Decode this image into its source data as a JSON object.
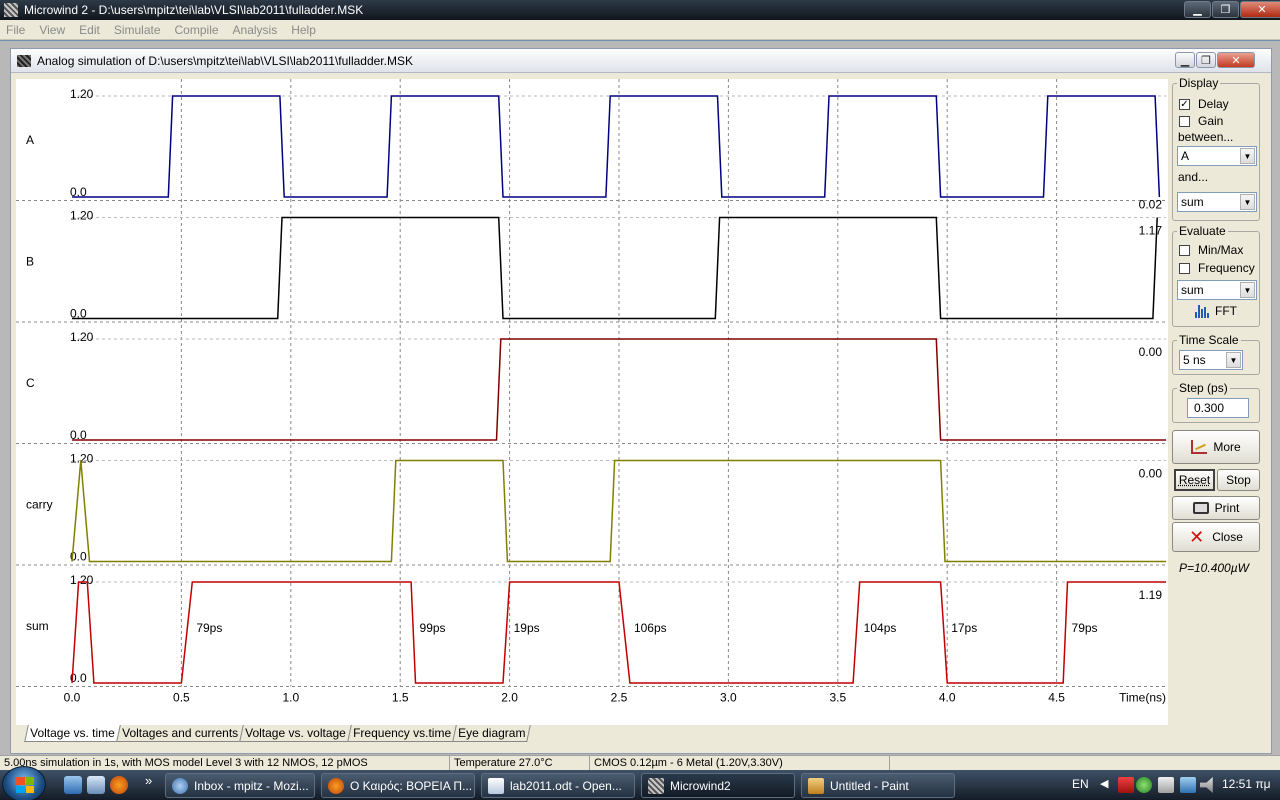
{
  "main_window": {
    "title": "Microwind 2 - D:\\users\\mpitz\\tei\\lab\\VLSI\\lab2011\\fulladder.MSK"
  },
  "menu": [
    "File",
    "View",
    "Edit",
    "Simulate",
    "Compile",
    "Analysis",
    "Help"
  ],
  "child_window": {
    "title": "Analog simulation of D:\\users\\mpitz\\tei\\lab\\VLSI\\lab2011\\fulladder.MSK"
  },
  "chart_data": {
    "type": "line",
    "xlabel": "Time(ns)",
    "xlim": [
      0,
      5
    ],
    "x_ticks": [
      "0.0",
      "0.5",
      "1.0",
      "1.5",
      "2.0",
      "2.5",
      "3.0",
      "3.5",
      "4.0",
      "4.5"
    ],
    "series": [
      {
        "name": "A",
        "color": "#000080",
        "ymax_label": "1.20",
        "ymin_label": "0.0",
        "right_value": "0.02",
        "points": [
          [
            0,
            0
          ],
          [
            0.44,
            0
          ],
          [
            0.46,
            1.2
          ],
          [
            0.95,
            1.2
          ],
          [
            0.97,
            0
          ],
          [
            1.44,
            0
          ],
          [
            1.46,
            1.2
          ],
          [
            1.95,
            1.2
          ],
          [
            1.97,
            0
          ],
          [
            2.44,
            0
          ],
          [
            2.46,
            1.2
          ],
          [
            2.95,
            1.2
          ],
          [
            2.97,
            0
          ],
          [
            3.44,
            0
          ],
          [
            3.46,
            1.2
          ],
          [
            3.95,
            1.2
          ],
          [
            3.97,
            0
          ],
          [
            4.44,
            0
          ],
          [
            4.46,
            1.2
          ],
          [
            4.95,
            1.2
          ],
          [
            4.97,
            0
          ]
        ]
      },
      {
        "name": "B",
        "color": "#000000",
        "ymax_label": "1.20",
        "ymin_label": "0.0",
        "right_value": "1.17",
        "points": [
          [
            0,
            0
          ],
          [
            0.94,
            0
          ],
          [
            0.96,
            1.2
          ],
          [
            1.95,
            1.2
          ],
          [
            1.97,
            0
          ],
          [
            2.94,
            0
          ],
          [
            2.96,
            1.2
          ],
          [
            3.95,
            1.2
          ],
          [
            3.97,
            0
          ],
          [
            4.94,
            0
          ],
          [
            4.96,
            1.2
          ]
        ]
      },
      {
        "name": "C",
        "color": "#800000",
        "ymax_label": "1.20",
        "ymin_label": "0.0",
        "right_value": "0.00",
        "points": [
          [
            0,
            0
          ],
          [
            1.94,
            0
          ],
          [
            1.96,
            1.2
          ],
          [
            3.95,
            1.2
          ],
          [
            3.97,
            0
          ],
          [
            5,
            0
          ]
        ]
      },
      {
        "name": "carry",
        "color": "#808000",
        "ymax_label": "1.20",
        "ymin_label": "0.0",
        "right_value": "0.00",
        "points": [
          [
            0,
            0
          ],
          [
            0.02,
            0.6
          ],
          [
            0.04,
            1.2
          ],
          [
            0.06,
            0.6
          ],
          [
            0.08,
            0
          ],
          [
            1.46,
            0
          ],
          [
            1.48,
            1.2
          ],
          [
            1.97,
            1.2
          ],
          [
            1.99,
            0
          ],
          [
            2.46,
            0
          ],
          [
            2.48,
            1.2
          ],
          [
            3.97,
            1.2
          ],
          [
            3.99,
            0
          ],
          [
            5,
            0
          ]
        ]
      },
      {
        "name": "sum",
        "color": "#c00000",
        "ymax_label": "1.20",
        "ymin_label": "0.0",
        "right_value": "1.19",
        "points": [
          [
            0,
            0
          ],
          [
            0.03,
            1.2
          ],
          [
            0.07,
            1.2
          ],
          [
            0.1,
            0
          ],
          [
            0.5,
            0
          ],
          [
            0.55,
            1.2
          ],
          [
            1.55,
            1.2
          ],
          [
            1.57,
            0
          ],
          [
            1.97,
            0
          ],
          [
            2,
            1.2
          ],
          [
            2.5,
            1.2
          ],
          [
            2.55,
            0
          ],
          [
            3.57,
            0
          ],
          [
            3.6,
            1.2
          ],
          [
            3.97,
            1.2
          ],
          [
            4,
            0
          ],
          [
            4.53,
            0
          ],
          [
            4.55,
            1.2
          ],
          [
            5,
            1.2
          ]
        ]
      }
    ],
    "annotations": [
      {
        "series": "sum",
        "x": 0.55,
        "text": "79ps"
      },
      {
        "series": "sum",
        "x": 1.57,
        "text": "99ps"
      },
      {
        "series": "sum",
        "x": 2.0,
        "text": "19ps"
      },
      {
        "series": "sum",
        "x": 2.55,
        "text": "106ps"
      },
      {
        "series": "sum",
        "x": 3.6,
        "text": "104ps"
      },
      {
        "series": "sum",
        "x": 4.0,
        "text": "17ps"
      },
      {
        "series": "sum",
        "x": 4.55,
        "text": "79ps"
      }
    ]
  },
  "panel": {
    "display_title": "Display",
    "delay_label": "Delay",
    "delay_checked": true,
    "gain_label": "Gain",
    "gain_checked": false,
    "between_label": "between...",
    "between_value": "A",
    "and_label": "and...",
    "and_value": "sum",
    "evaluate_title": "Evaluate",
    "minmax_label": "Min/Max",
    "minmax_checked": false,
    "frequency_label": "Frequency",
    "frequency_checked": false,
    "evaluate_value": "sum",
    "fft_label": "FFT",
    "timescale_title": "Time Scale",
    "timescale_value": "5 ns",
    "step_title": "Step (ps)",
    "step_value": "0.300",
    "more_label": "More",
    "reset_label": "Reset",
    "stop_label": "Stop",
    "print_label": "Print",
    "close_label": "Close",
    "power_text": "P=10.400µW"
  },
  "tabs": [
    "Voltage vs. time",
    "Voltages and currents",
    "Voltage vs. voltage",
    "Frequency vs.time",
    "Eye diagram"
  ],
  "status": [
    "5.00ns simulation in 1s, with MOS model Level 3 with 12 NMOS, 12 pMOS",
    "Temperature 27.0°C",
    "CMOS 0.12µm - 6 Metal (1.20V,3.30V)"
  ],
  "taskbar": {
    "items": [
      "Inbox - mpitz - Mozi...",
      "Ο Καιρός: ΒΟΡΕΙΑ Π...",
      "lab2011.odt - Open...",
      "Microwind2",
      "Untitled - Paint"
    ],
    "language": "EN",
    "clock": "12:51 πμ",
    "overflow": "»"
  }
}
